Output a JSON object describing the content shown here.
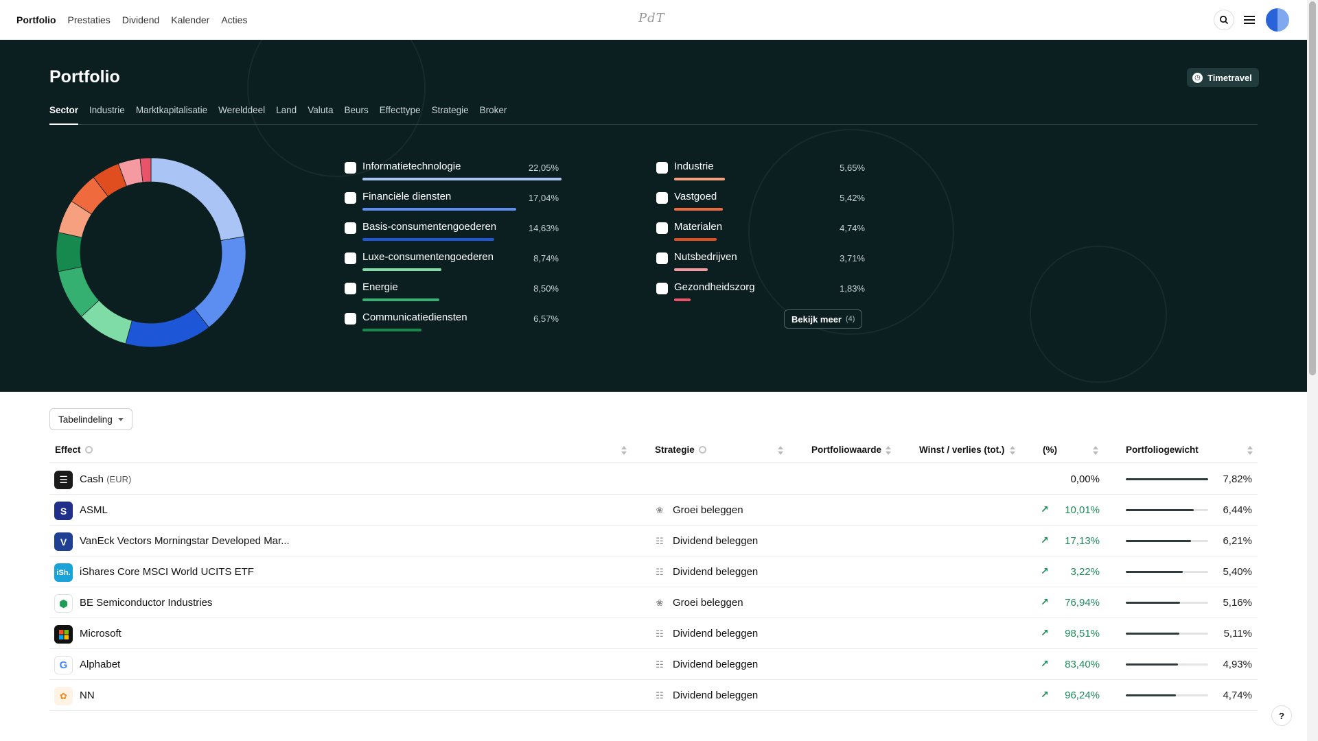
{
  "nav": {
    "links": [
      "Portfolio",
      "Prestaties",
      "Dividend",
      "Kalender",
      "Acties"
    ],
    "logo_text": "PdT"
  },
  "hero": {
    "title": "Portfolio",
    "timetravel_label": "Timetravel",
    "tabs": [
      "Sector",
      "Industrie",
      "Marktkapitalisatie",
      "Werelddeel",
      "Land",
      "Valuta",
      "Beurs",
      "Effecttype",
      "Strategie",
      "Broker"
    ],
    "active_tab": "Sector",
    "bekijk_meer_label": "Bekijk meer",
    "bekijk_meer_count": "(4)"
  },
  "chart_data": {
    "type": "pie",
    "donut": true,
    "categories": [
      "Informatietechnologie",
      "Financiële diensten",
      "Basis-consumentengoederen",
      "Luxe-consumentengoederen",
      "Energie",
      "Communicatiediensten",
      "Industrie",
      "Vastgoed",
      "Materialen",
      "Nutsbedrijven",
      "Gezondheidszorg"
    ],
    "values": [
      22.05,
      17.04,
      14.63,
      8.74,
      8.5,
      6.57,
      5.65,
      5.42,
      4.74,
      3.71,
      1.83
    ],
    "labels": [
      "22,05%",
      "17,04%",
      "14,63%",
      "8,74%",
      "8,50%",
      "6,57%",
      "5,65%",
      "5,42%",
      "4,74%",
      "3,71%",
      "1,83%"
    ],
    "colors": [
      "#a9c4f5",
      "#5b8ef0",
      "#1d57d8",
      "#7fdca7",
      "#35b071",
      "#16894f",
      "#f7a07f",
      "#ef6a3d",
      "#e04d1f",
      "#f49aa0",
      "#e8546a"
    ]
  },
  "table": {
    "tabelindeling_label": "Tabelindeling",
    "headers": {
      "effect": "Effect",
      "strategie": "Strategie",
      "portfoliowaarde": "Portfoliowaarde",
      "winst": "Winst / verlies (tot.)",
      "pct": "(%)",
      "gewicht": "Portfoliogewicht"
    },
    "rows": [
      {
        "name": "Cash",
        "currency": "(EUR)",
        "logo": "cash-icon",
        "logo_bg": "#1a1a1a",
        "strategy": "",
        "strategy_icon": "",
        "pct": "0,00%",
        "up": false,
        "weight": "7,82%",
        "weight_value": 7.82
      },
      {
        "name": "ASML",
        "currency": "",
        "logo": "asml-logo",
        "logo_bg": "#20308a",
        "strategy": "Groei beleggen",
        "strategy_icon": "sprout-icon",
        "pct": "10,01%",
        "up": true,
        "weight": "6,44%",
        "weight_value": 6.44
      },
      {
        "name": "VanEck Vectors Morningstar Developed Mar...",
        "currency": "",
        "logo": "vaneck-logo",
        "logo_bg": "#1e3f92",
        "strategy": "Dividend beleggen",
        "strategy_icon": "coins-icon",
        "pct": "17,13%",
        "up": true,
        "weight": "6,21%",
        "weight_value": 6.21
      },
      {
        "name": "iShares Core MSCI World UCITS ETF",
        "currency": "",
        "logo": "ishares-logo",
        "logo_bg": "#1aa3d9",
        "strategy": "Dividend beleggen",
        "strategy_icon": "coins-icon",
        "pct": "3,22%",
        "up": true,
        "weight": "5,40%",
        "weight_value": 5.4
      },
      {
        "name": "BE Semiconductor Industries",
        "currency": "",
        "logo": "besi-logo",
        "logo_bg": "#ffffff",
        "strategy": "Groei beleggen",
        "strategy_icon": "sprout-icon",
        "pct": "76,94%",
        "up": true,
        "weight": "5,16%",
        "weight_value": 5.16
      },
      {
        "name": "Microsoft",
        "currency": "",
        "logo": "microsoft-logo",
        "logo_bg": "#111111",
        "strategy": "Dividend beleggen",
        "strategy_icon": "coins-icon",
        "pct": "98,51%",
        "up": true,
        "weight": "5,11%",
        "weight_value": 5.11
      },
      {
        "name": "Alphabet",
        "currency": "",
        "logo": "google-logo",
        "logo_bg": "#ffffff",
        "strategy": "Dividend beleggen",
        "strategy_icon": "coins-icon",
        "pct": "83,40%",
        "up": true,
        "weight": "4,93%",
        "weight_value": 4.93
      },
      {
        "name": "NN",
        "currency": "",
        "logo": "nn-logo",
        "logo_bg": "#fff3e6",
        "strategy": "Dividend beleggen",
        "strategy_icon": "coins-icon",
        "pct": "96,24%",
        "up": true,
        "weight": "4,74%",
        "weight_value": 4.74
      }
    ]
  },
  "help_label": "?"
}
